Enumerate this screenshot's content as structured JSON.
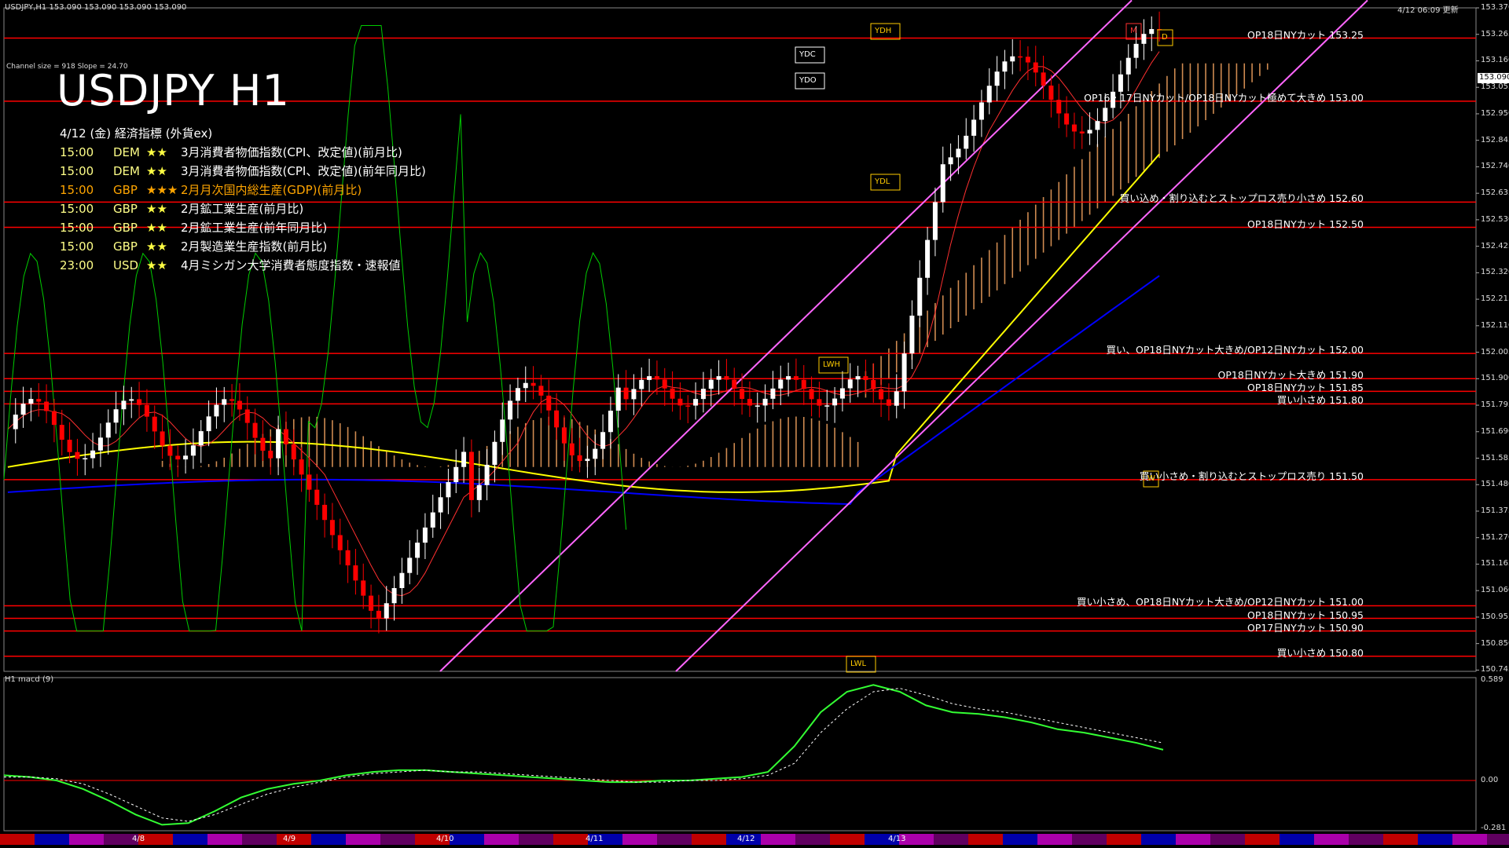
{
  "header": {
    "symbol_line": "USDJPY,H1  153.090 153.090 153.090 153.090",
    "updated": "4/12 06:09 更新",
    "channel_info": "Channel size = 918 Slope = 24.70",
    "macd_label": "H1  macd (9)"
  },
  "title": "USDJPY H1",
  "events_header": "4/12 (金) 経済指標 (外貨ex)",
  "events": [
    {
      "time": "15:00",
      "currency": "DEM",
      "stars": "★★",
      "name": "3月消費者物価指数(CPI、改定値)(前月比)",
      "highlight": false
    },
    {
      "time": "15:00",
      "currency": "DEM",
      "stars": "★★",
      "name": "3月消費者物価指数(CPI、改定値)(前年同月比)",
      "highlight": false
    },
    {
      "time": "15:00",
      "currency": "GBP",
      "stars": "★★★",
      "name": "2月月次国内総生産(GDP)(前月比)",
      "highlight": true
    },
    {
      "time": "15:00",
      "currency": "GBP",
      "stars": "★★",
      "name": "2月鉱工業生産(前月比)",
      "highlight": false
    },
    {
      "time": "15:00",
      "currency": "GBP",
      "stars": "★★",
      "name": "2月鉱工業生産(前年同月比)",
      "highlight": false
    },
    {
      "time": "15:00",
      "currency": "GBP",
      "stars": "★★",
      "name": "2月製造業生産指数(前月比)",
      "highlight": false
    },
    {
      "time": "23:00",
      "currency": "USD",
      "stars": "★★",
      "name": "4月ミシガン大学消費者態度指数・速報値",
      "highlight": false
    }
  ],
  "colors": {
    "level_line": "#ff0000",
    "up_candle": "#ffffff",
    "down_candle": "#ff0000",
    "cloud": "#f4a460",
    "ma_yellow": "#ffff00",
    "ma_blue": "#0000ff",
    "channel": "#ff66ff",
    "rsi_green": "#00cc00",
    "event_text": "#ffff88",
    "highlight_text": "#ffa500",
    "macd_line": "#33ff33"
  },
  "chart_data": {
    "type": "candlestick",
    "ylim": [
      150.74,
      153.37
    ],
    "y_ticks": [
      "153.370",
      "153.265",
      "153.160",
      "153.055",
      "152.950",
      "152.845",
      "152.740",
      "152.635",
      "152.530",
      "152.425",
      "152.320",
      "152.215",
      "152.110",
      "152.005",
      "151.900",
      "151.795",
      "151.690",
      "151.585",
      "151.480",
      "151.375",
      "151.270",
      "151.165",
      "151.060",
      "150.955",
      "150.850",
      "150.745"
    ],
    "current_price": "153.090",
    "x_ticks": [
      "4/8",
      "4/9",
      "4/10",
      "4/11",
      "4/12",
      "4/13"
    ],
    "price_levels": [
      {
        "label": "OP18日NYカット 153.25",
        "price": 153.25
      },
      {
        "label": "OP16・17日NYカット/OP18日NYカット極めて大きめ 153.00",
        "price": 153.0
      },
      {
        "label": "買い込め・割り込むとストップロス売り小さめ 152.60",
        "price": 152.6
      },
      {
        "label": "OP18日NYカット 152.50",
        "price": 152.5
      },
      {
        "label": "買い、OP18日NYカット大きめ/OP12日NYカット 152.00",
        "price": 152.0
      },
      {
        "label": "OP18日NYカット大きめ 151.90",
        "price": 151.9
      },
      {
        "label": "OP18日NYカット 151.85",
        "price": 151.85
      },
      {
        "label": "買い小さめ 151.80",
        "price": 151.8
      },
      {
        "label": "買い小さめ・割り込むとストップロス売り 151.50",
        "price": 151.5
      },
      {
        "label": "買い小さめ、OP18日NYカット大きめ/OP12日NYカット 151.00",
        "price": 151.0
      },
      {
        "label": "OP18日NYカット 150.95",
        "price": 150.95
      },
      {
        "label": "OP17日NYカット 150.90",
        "price": 150.9
      },
      {
        "label": "買い小さめ 150.80",
        "price": 150.8
      }
    ],
    "marker_labels": [
      "YDH",
      "YDC",
      "YDO",
      "YDL",
      "LWH",
      "LWL",
      "W",
      "M",
      "D"
    ],
    "macd_ticks": [
      "0.589",
      "0.00",
      "-0.281"
    ],
    "macd_ylim": [
      -0.281,
      0.589
    ],
    "macd_line": [
      0.03,
      0.02,
      0.0,
      -0.05,
      -0.12,
      -0.2,
      -0.26,
      -0.25,
      -0.18,
      -0.1,
      -0.05,
      -0.02,
      0.0,
      0.03,
      0.05,
      0.06,
      0.06,
      0.05,
      0.04,
      0.03,
      0.02,
      0.01,
      0.0,
      -0.01,
      -0.01,
      0.0,
      0.0,
      0.01,
      0.02,
      0.05,
      0.2,
      0.4,
      0.52,
      0.56,
      0.52,
      0.44,
      0.4,
      0.39,
      0.37,
      0.34,
      0.3,
      0.28,
      0.25,
      0.22,
      0.18
    ],
    "macd_signal": [
      0.02,
      0.02,
      0.01,
      -0.02,
      -0.08,
      -0.15,
      -0.22,
      -0.24,
      -0.2,
      -0.14,
      -0.08,
      -0.04,
      -0.01,
      0.02,
      0.04,
      0.05,
      0.06,
      0.05,
      0.05,
      0.04,
      0.03,
      0.02,
      0.01,
      0.0,
      -0.01,
      -0.01,
      0.0,
      0.0,
      0.01,
      0.03,
      0.1,
      0.28,
      0.42,
      0.52,
      0.54,
      0.5,
      0.45,
      0.42,
      0.4,
      0.37,
      0.34,
      0.31,
      0.28,
      0.25,
      0.22
    ]
  }
}
